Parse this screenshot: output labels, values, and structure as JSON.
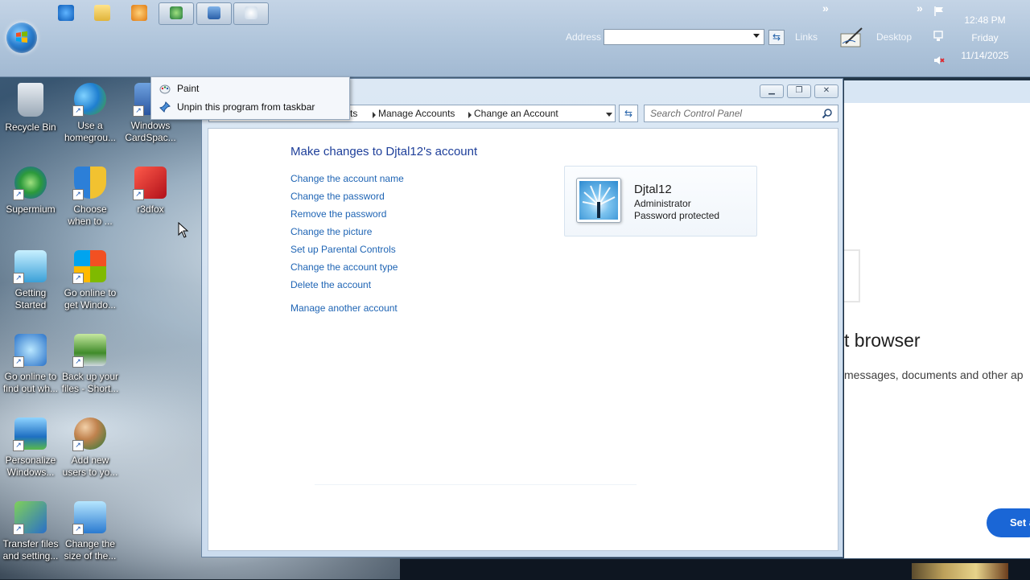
{
  "taskbar": {
    "address_label": "Address",
    "address_value": "",
    "links_label": "Links",
    "desktop_label": "Desktop",
    "clock": {
      "time": "12:48 PM",
      "day": "Friday",
      "date": "11/14/2025"
    }
  },
  "jump_list": {
    "items": [
      "Paint",
      "Unpin this program from taskbar"
    ]
  },
  "desktop_icons": [
    "Recycle Bin",
    "Use a\nhomegrou...",
    "Windows\nCardSpac...",
    "Supermium",
    "Choose\nwhen to ...",
    "r3dfox",
    "Getting\nStarted",
    "Go online to\nget Windo...",
    "Go online to\nfind out wh...",
    "Back up your\nfiles - Short...",
    "Personalize\nWindows...",
    "Add new\nusers to yo...",
    "Transfer files\nand setting...",
    "Change the\nsize of the..."
  ],
  "control_panel": {
    "breadcrumbs": [
      "ts",
      "Manage Accounts",
      "Change an Account"
    ],
    "search_placeholder": "Search Control Panel",
    "title": "Make changes to Djtal12's account",
    "links": [
      "Change the account name",
      "Change the password",
      "Remove the password",
      "Change the picture",
      "Set up Parental Controls",
      "Change the account type",
      "Delete the account"
    ],
    "manage_link": "Manage another account",
    "account": {
      "name": "Djtal12",
      "type": "Administrator",
      "status": "Password protected"
    }
  },
  "background_window": {
    "heading": "t browser",
    "text": "messages, documents and other ap",
    "button": "Set a"
  },
  "colors": {
    "link": "#1e64b4",
    "title": "#1e3f9a",
    "taskbar": "#b0c5db",
    "accent_button": "#1a66d6"
  }
}
